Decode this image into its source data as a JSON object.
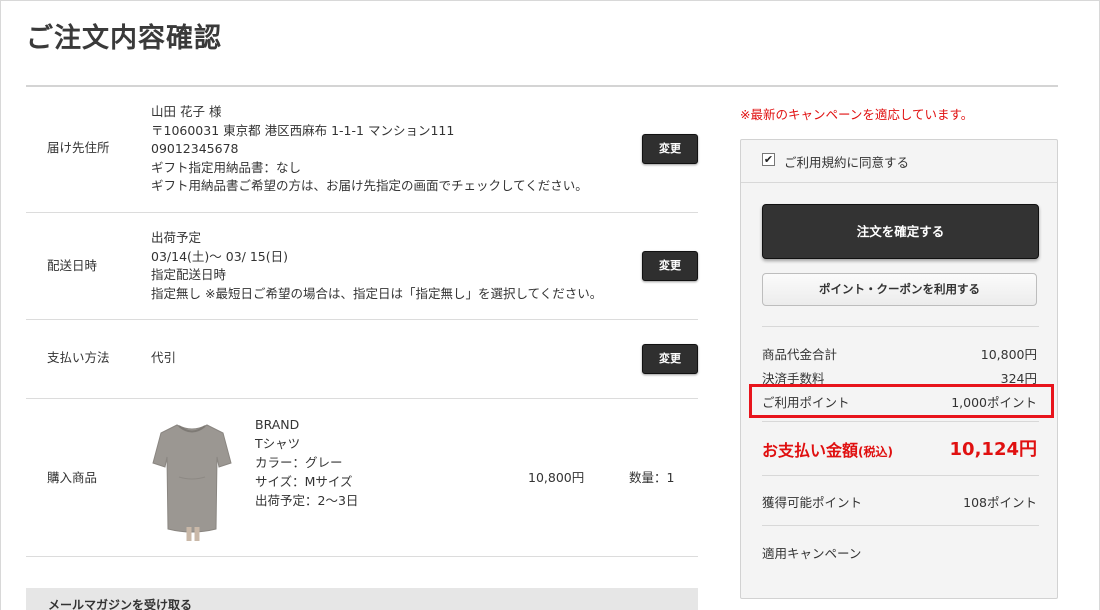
{
  "page": {
    "title": "ご注文内容確認"
  },
  "delivery": {
    "label": "届け先住所",
    "name": "山田 花子 様",
    "address": "〒1060031 東京都 港区西麻布 1-1-1 マンション111",
    "phone": "09012345678",
    "gift_slip": "ギフト指定用納品書：なし",
    "gift_note": "ギフト用納品書ご希望の方は、お届け先指定の画面でチェックしてください。",
    "change_label": "変更"
  },
  "shipping": {
    "label": "配送日時",
    "line1": "出荷予定",
    "line2": "03/14(土)～ 03/ 15(日)",
    "line3": "指定配送日時",
    "line4": "指定無し ※最短日ご希望の場合は、指定日は「指定無し」を選択してください。",
    "change_label": "変更"
  },
  "payment": {
    "label": "支払い方法",
    "value": "代引",
    "change_label": "変更"
  },
  "product": {
    "label": "購入商品",
    "brand": "BRAND",
    "name": "Tシャツ",
    "color": "カラー：グレー",
    "size": "サイズ：Mサイズ",
    "ship": "出荷予定：2～3日",
    "price": "10,800円",
    "qty": "数量：1"
  },
  "mail": {
    "label": "メールマガジンを受け取る"
  },
  "sidebar": {
    "notice": "※最新のキャンペーンを適応しています。",
    "agree_label": "ご利用規約に同意する",
    "agree_check": "✔",
    "confirm_label": "注文を確定する",
    "point_button_label": "ポイント・クーポンを利用する",
    "subtotal_label": "商品代金合計",
    "subtotal_value": "10,800円",
    "fee_label": "決済手数料",
    "fee_value": "324円",
    "points_used_label": "ご利用ポイント",
    "points_used_value": "1,000ポイント",
    "total_label": "お支払い金額",
    "total_tax": "(税込)",
    "total_value": "10,124円",
    "earn_label": "獲得可能ポイント",
    "earn_value": "108ポイント",
    "campaign_label": "適用キャンペーン"
  },
  "colors": {
    "accent_red": "#e01010",
    "button_dark": "#333333",
    "highlight": "#e8141c"
  },
  "icons": {
    "checkbox": "checkmark-icon",
    "product_image": "tshirt-icon"
  }
}
